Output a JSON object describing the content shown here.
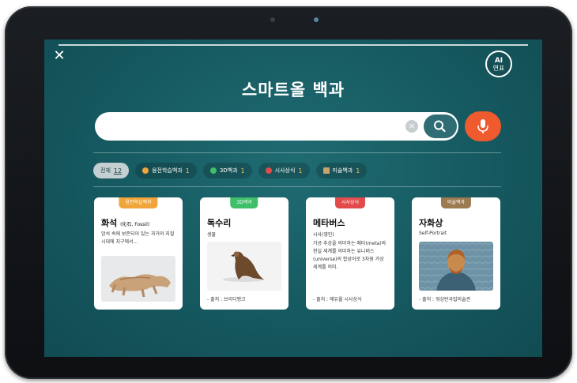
{
  "app": {
    "title": "스마트올 백과",
    "badge_top": "AI",
    "badge_bottom": "연표",
    "close_label": "✕"
  },
  "search": {
    "value": "",
    "placeholder": "",
    "clear_label": "×"
  },
  "filters": [
    {
      "label": "전체",
      "count": "12",
      "active": true
    },
    {
      "label": "융전학습백과",
      "count": "1",
      "dot_color": "#f0a43a"
    },
    {
      "label": "3D백과",
      "count": "1",
      "dot_color": "#3fbf6a"
    },
    {
      "label": "시사상식",
      "count": "1",
      "dot_color": "#e24b4b"
    },
    {
      "label": "미술백과",
      "count": "1",
      "dot_color": "#c9a36b"
    }
  ],
  "cards": [
    {
      "tag": "융전학습백과",
      "tag_color": "#f0a43a",
      "title": "화석",
      "title_note": "(化石, Fossil)",
      "text": "암석 속에 보존되어 있는 과거의 지질시대에 지구에서...",
      "image": "fossil-image"
    },
    {
      "tag": "3D백과",
      "tag_color": "#3fbf6a",
      "title": "독수리",
      "subtitle": "생물",
      "source": "- 출처 : 브리디맹크",
      "image": "eagle-image"
    },
    {
      "tag": "시사상식",
      "tag_color": "#e24b4b",
      "title": "메타버스",
      "subtitle": "시사(영인)",
      "text": "가공·추상을 의미하는 메타(meta)와 현실 세계를 의미하는 유니버스(universe)의 합성어로 3차원 가상세계를 의미.",
      "source": "- 출처 : 에듀윌 시사상식"
    },
    {
      "tag": "미술백과",
      "tag_color": "#9c7b52",
      "title": "자화상",
      "subtitle": "Self-Portrait",
      "source": "- 출처 : 워싱턴국립미술관",
      "image": "self-portrait-image"
    }
  ],
  "icons": {
    "close": "close-icon",
    "search": "search-icon",
    "mic": "mic-icon",
    "clear": "clear-icon"
  },
  "colors": {
    "screen_bg": "#165960",
    "mic_button": "#ef5a2f",
    "search_button": "#2f6d75"
  }
}
